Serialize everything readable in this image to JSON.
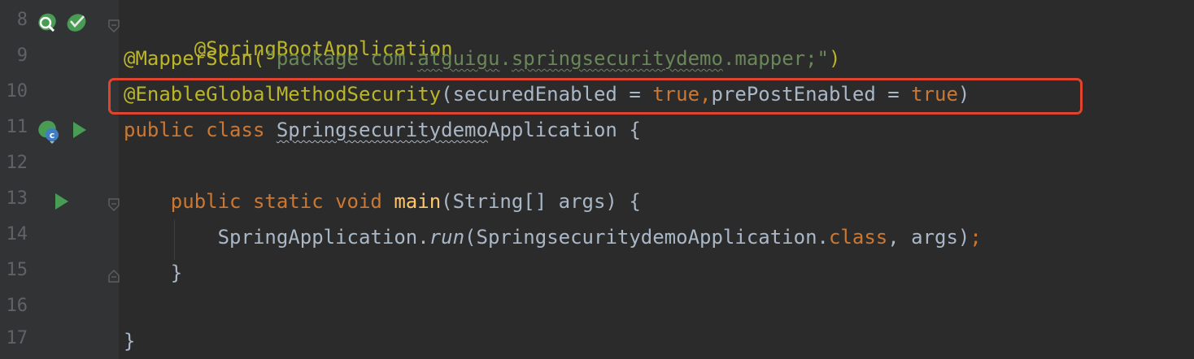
{
  "lines": [
    {
      "num": "8",
      "parts": [
        "@SpringBootApplication"
      ]
    },
    {
      "num": "9",
      "parts": [
        "@MapperScan(",
        "\"package ",
        "com",
        ".",
        "atguigu",
        ".",
        "springsecuritydemo",
        ".",
        "mapper",
        ";\"",
        ")"
      ]
    },
    {
      "num": "10",
      "parts": [
        "@EnableGlobalMethodSecurity",
        "(securedEnabled = ",
        "true",
        ",",
        "prePostEnabled = ",
        "true",
        ")"
      ]
    },
    {
      "num": "11",
      "parts": [
        "public class ",
        "Springsecuritydemo",
        "Application {"
      ]
    },
    {
      "num": "12",
      "parts": []
    },
    {
      "num": "13",
      "parts": [
        "    public static void ",
        "main",
        "(String[] args) {"
      ]
    },
    {
      "num": "14",
      "parts": [
        "        SpringApplication.",
        "run",
        "(SpringsecuritydemoApplication.",
        "class",
        ", args)",
        ";"
      ]
    },
    {
      "num": "15",
      "parts": [
        "    }"
      ]
    },
    {
      "num": "16",
      "parts": []
    },
    {
      "num": "17",
      "parts": [
        "}"
      ]
    }
  ],
  "colors": {
    "background": "#2b2b2b",
    "gutter": "#313335",
    "annotation": "#bbb529",
    "keyword": "#cc7832",
    "string": "#6a8759",
    "function": "#ffc66d",
    "highlight_border": "#e0442e",
    "run_icon": "#499c54"
  },
  "icons": {
    "line8": [
      "bean-search-icon",
      "spring-check-icon"
    ],
    "line11": [
      "spring-app-icon",
      "run-icon"
    ],
    "line13": [
      "run-icon"
    ]
  }
}
